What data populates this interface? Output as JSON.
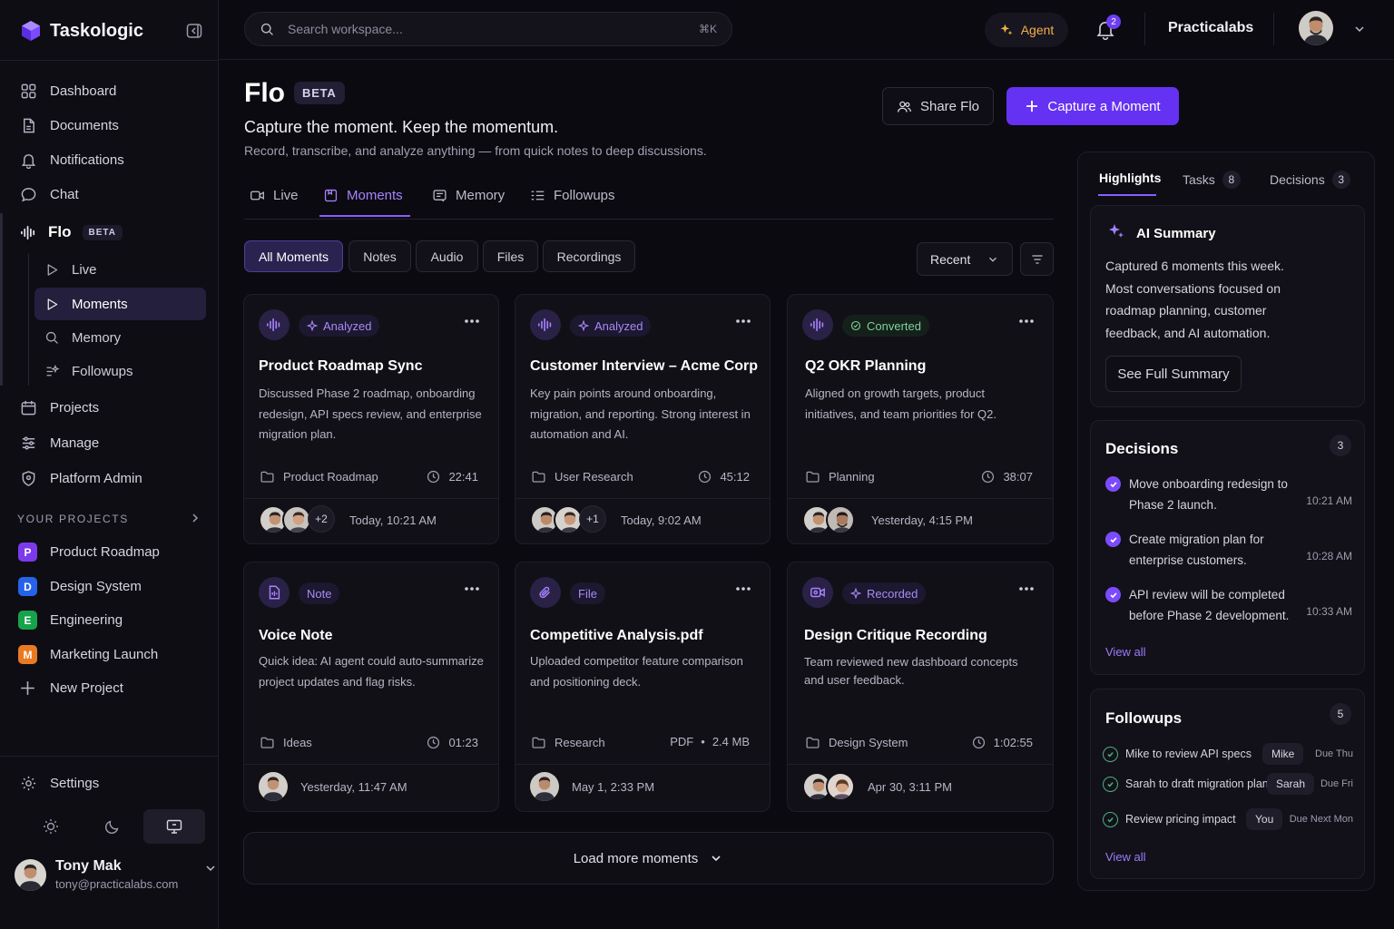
{
  "brand": {
    "name": "Taskologic",
    "accent": "#6531f2"
  },
  "sidebar": {
    "nav": [
      {
        "label": "Dashboard",
        "icon": "grid-icon"
      },
      {
        "label": "Documents",
        "icon": "document-icon"
      },
      {
        "label": "Notifications",
        "icon": "bell-icon"
      },
      {
        "label": "Chat",
        "icon": "chat-icon"
      }
    ],
    "flo": {
      "label": "Flo",
      "badge": "BETA"
    },
    "flo_items": [
      {
        "label": "Live"
      },
      {
        "label": "Moments",
        "active": true
      },
      {
        "label": "Memory"
      },
      {
        "label": "Followups"
      }
    ],
    "nav2": [
      {
        "label": "Projects"
      },
      {
        "label": "Manage"
      },
      {
        "label": "Platform Admin"
      }
    ],
    "projects_label": "YOUR PROJECTS",
    "projects": [
      {
        "letter": "P",
        "label": "Product Roadmap",
        "color": "#7c3aed"
      },
      {
        "letter": "D",
        "label": "Design System",
        "color": "#2563eb"
      },
      {
        "letter": "E",
        "label": "Engineering",
        "color": "#16a34a"
      },
      {
        "letter": "M",
        "label": "Marketing Launch",
        "color": "#ea7a22"
      }
    ],
    "new_project": "New Project",
    "settings": "Settings",
    "theme": "system",
    "user": {
      "name": "Tony Mak",
      "email": "tony@practicalabs.com"
    }
  },
  "topbar": {
    "search_placeholder": "Search workspace...",
    "shortcut": "⌘K",
    "agent": "Agent",
    "notif_count": "2",
    "org": "Practicalabs"
  },
  "page": {
    "title": "Flo",
    "badge": "BETA",
    "subtitle": "Capture the moment. Keep the momentum.",
    "description": "Record, transcribe, and analyze anything — from quick notes to deep discussions.",
    "share": "Share Flo",
    "capture": "Capture a Moment"
  },
  "tabs": [
    {
      "label": "Live"
    },
    {
      "label": "Moments",
      "active": true
    },
    {
      "label": "Memory"
    },
    {
      "label": "Followups"
    }
  ],
  "filters": [
    "All Moments",
    "Notes",
    "Audio",
    "Files",
    "Recordings"
  ],
  "sort": "Recent",
  "cards": [
    {
      "status": "Analyzed",
      "title": "Product Roadmap Sync",
      "desc": "Discussed Phase 2 roadmap, onboarding redesign, API specs review, and enterprise migration plan.",
      "folder": "Product Roadmap",
      "meta": "22:41",
      "extra": "+2",
      "date": "Today, 10:21 AM"
    },
    {
      "status": "Analyzed",
      "title": "Customer Interview – Acme Corp",
      "desc": "Key pain points around onboarding, migration, and reporting. Strong interest in automation and AI.",
      "folder": "User Research",
      "meta": "45:12",
      "extra": "+1",
      "date": "Today, 9:02 AM"
    },
    {
      "status": "Converted",
      "title": "Q2 OKR Planning",
      "desc": "Aligned on growth targets, product initiatives, and team priorities for Q2.",
      "folder": "Planning",
      "meta": "38:07",
      "extra": "",
      "date": "Yesterday, 4:15 PM"
    },
    {
      "status": "Note",
      "title": "Voice Note",
      "desc": "Quick idea: AI agent could auto-summarize project updates and flag risks.",
      "folder": "Ideas",
      "meta": "01:23",
      "extra": "",
      "date": "Yesterday, 11:47 AM"
    },
    {
      "status": "File",
      "title": "Competitive Analysis.pdf",
      "desc": "Uploaded competitor feature comparison and positioning deck.",
      "folder": "Research",
      "meta_type": "PDF",
      "meta": "2.4 MB",
      "extra": "",
      "date": "May 1, 2:33 PM"
    },
    {
      "status": "Recorded",
      "title": "Design Critique Recording",
      "desc": "Team reviewed new dashboard concepts and user feedback.",
      "folder": "Design System",
      "meta": "1:02:55",
      "extra": "",
      "date": "Apr 30, 3:11 PM"
    }
  ],
  "load_more": "Load more moments",
  "right": {
    "tabs": [
      {
        "label": "Highlights"
      },
      {
        "label": "Tasks",
        "count": "8"
      },
      {
        "label": "Decisions",
        "count": "3"
      }
    ],
    "ai": {
      "title": "AI Summary",
      "text": "Captured 6 moments this week. Most conversations focused on roadmap planning, customer feedback, and AI automation.",
      "button": "See Full Summary"
    },
    "decisions": {
      "title": "Decisions",
      "count": "3",
      "items": [
        {
          "text": "Move onboarding redesign to Phase 2 launch.",
          "time": "10:21 AM"
        },
        {
          "text": "Create migration plan for enterprise customers.",
          "time": "10:28 AM"
        },
        {
          "text": "API review will be completed before Phase 2 development.",
          "time": "10:33 AM"
        }
      ],
      "view_all": "View all"
    },
    "followups": {
      "title": "Followups",
      "count": "5",
      "items": [
        {
          "text": "Mike to review API specs",
          "who": "Mike",
          "due": "Due Thu"
        },
        {
          "text": "Sarah to draft migration plan",
          "who": "Sarah",
          "due": "Due Fri"
        },
        {
          "text": "Review pricing impact",
          "who": "You",
          "due": "Due Next Mon"
        }
      ],
      "view_all": "View all"
    }
  }
}
